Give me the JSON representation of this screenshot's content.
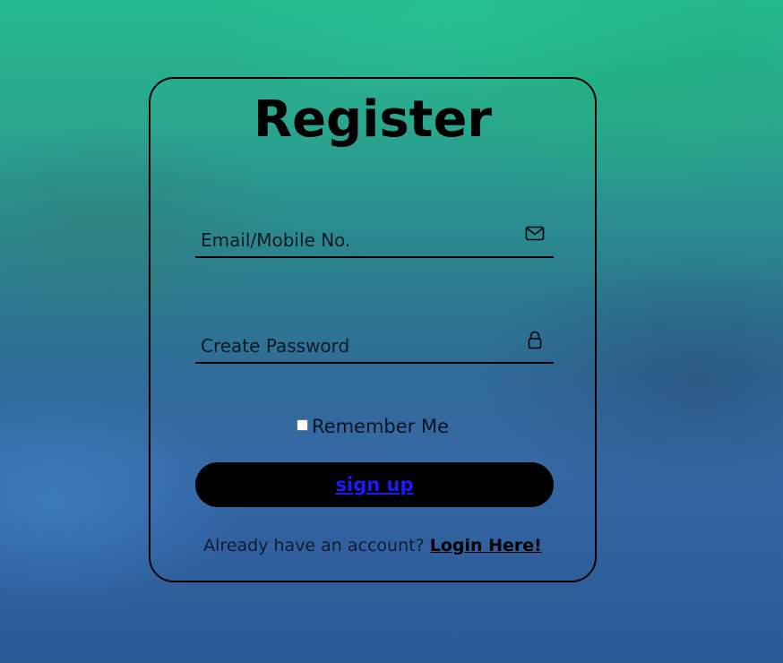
{
  "form": {
    "title": "Register",
    "email_placeholder": "Email/Mobile No.",
    "email_icon": "envelope-icon",
    "password_placeholder": "Create Password",
    "password_icon": "lock-icon",
    "remember_label": "Remember Me",
    "remember_checked": false,
    "signup_label": "sign up",
    "login_prompt": "Already have an account?",
    "login_link": "Login Here!"
  },
  "colors": {
    "button_bg": "#000000",
    "signup_text": "#1a1aff",
    "card_border": "#000000"
  }
}
